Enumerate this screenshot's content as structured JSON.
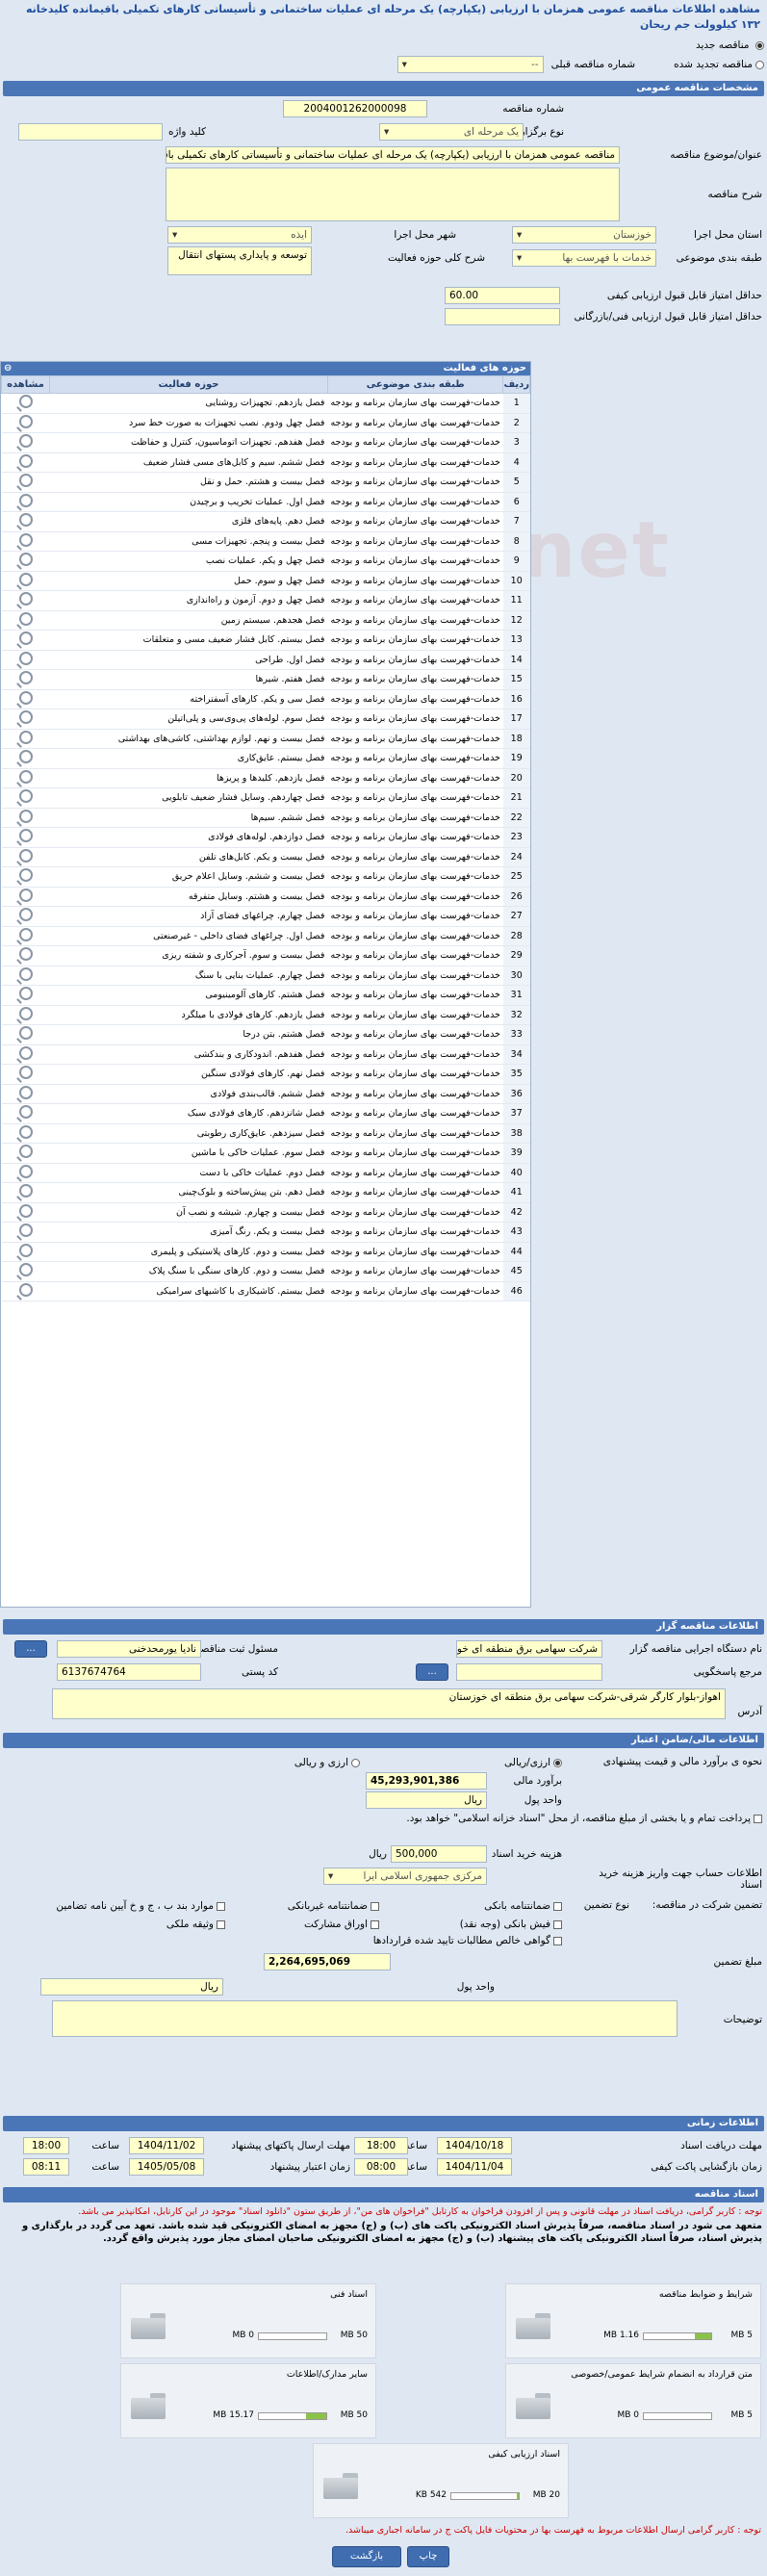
{
  "page_title": "مشاهده اطلاعات مناقصه عمومی همزمان با ارزیابی (یکپارچه) یک مرحله ای عملیات ساختمانی و تأسیساتی کارهای تکمیلی باقیمانده کلیدخانه ۱۳۲ کیلوولت جم ریحان",
  "new_tender_label": "مناقصه جدید",
  "renewed_tender_label": "مناقصه تجدید شده",
  "previous_tender_label": "شماره مناقصه قبلی",
  "previous_tender_value": "--",
  "sec_general": "مشخصات مناقصه عمومی",
  "tender_no_label": "شماره مناقصه",
  "tender_no": "2004001262000098",
  "hold_type_label": "نوع برگزاری",
  "hold_type": "یک مرحله ای",
  "keyword_label": "کلید واژه",
  "subject_label": "عنوان/موضوع مناقصه",
  "subject": "مناقصه عمومی همزمان با ارزیابی (یکپارچه) یک مرحله ای عملیات ساختمانی و تأسیساتی کارهای تکمیلی باقیمانده کلیدخانه ۱۳۲ کیلوولت جم ریحان",
  "description_label": "شرح مناقصه",
  "province_label": "استان محل اجرا",
  "province": "خوزستان",
  "city_label": "شهر محل اجرا",
  "city": "ایذه",
  "category_label": "طبقه بندی موضوعی",
  "category": "خدمات با فهرست بها",
  "scope_label": "شرح کلی حوزه فعالیت",
  "scope": "توسعه و پایداری پستهای انتقال",
  "min_quality_label": "حداقل امتیاز قابل قبول ارزیابی کیفی",
  "min_quality": "60.00",
  "min_tech_label": "حداقل امتیاز قابل قبول ارزیابی فنی/بازرگانی",
  "activity_title": "حوزه های فعالیت",
  "col_row": "ردیف",
  "col_cat": "طبقه بندی موضوعی",
  "col_act": "حوزه فعالیت",
  "col_view": "مشاهده",
  "cat_text": "خدمات-فهرست بهای سازمان برنامه و بودجه",
  "activities": [
    "فصل یازدهم. تجهیزات روشنایی",
    "فصل چهل ودوم. نصب تجهیزات به صورت خط سرد",
    "فصل هفدهم. تجهیزات اتوماسیون، کنترل و حفاظت",
    "فصل ششم. سیم و کابل‌های مسی فشار ضعیف",
    "فصل بیست و هشتم. حمل و نقل",
    "فصل اول. عملیات تخریب و برچیدن",
    "فصل دهم. پایه‌های فلزی",
    "فصل بیست و پنجم. تجهیزات مسی",
    "فصل چهل و یکم. عملیات نصب",
    "فصل چهل و سوم. حمل",
    "فصل چهل و دوم. آزمون و راه‌اندازی",
    "فصل هجدهم. سیستم زمین",
    "فصل بیستم. کابل فشار ضعیف مسی و متعلقات",
    "فصل اول. طراحی",
    "فصل هفتم. شیرها",
    "فصل سی و یکم. کارهای آسفتراخته",
    "فصل سوم. لوله‌های پی‌وی‌سی و پلی‌اتیلن",
    "فصل بیست و نهم. لوازم بهداشتی، کاشی‌های بهداشتی",
    "فصل بیستم. عایق‌کاری",
    "فصل یازدهم. کلیدها و پریزها",
    "فصل چهاردهم. وسایل فشار ضعیف تابلویی",
    "فصل ششم. سیم‌ها",
    "فصل دوازدهم. لوله‌های فولادی",
    "فصل بیست و یکم. کابل‌های تلفن",
    "فصل بیست و ششم. وسایل اعلام حریق",
    "فصل بیست و هشتم. وسایل متفرقه",
    "فصل چهارم. چراغهای فضای آزاد",
    "فصل اول. چراغهای فضای داخلی - غیرصنعتی",
    "فصل بیست و سوم. آجرکاری و شفته ریزی",
    "فصل چهارم. عملیات بنایی با سنگ",
    "فصل هشتم. کارهای آلومینیومی",
    "فصل یازدهم. کارهای فولادی با میلگرد",
    "فصل هشتم. بتن درجا",
    "فصل هفدهم. اندودکاری و بندکشی",
    "فصل نهم. کارهای فولادی سنگین",
    "فصل ششم. قالب‌بندی فولادی",
    "فصل شانزدهم. کارهای فولادی سبک",
    "فصل سیزدهم. عایق‌کاری رطوبتی",
    "فصل سوم. عملیات خاکی با ماشین",
    "فصل دوم. عملیات خاکی با دست",
    "فصل دهم. بتن پیش‌ساخته و بلوک‌چینی",
    "فصل بیست و چهارم. شیشه و نصب آن",
    "فصل بیست و یکم. رنگ آمیزی",
    "فصل بیست و دوم. کارهای پلاستیکی و پلیمری",
    "فصل بیست و دوم. کارهای سنگی با سنگ پلاک",
    "فصل بیستم. کاشیکاری با کاشیهای سرامیکی"
  ],
  "sec_organizer": "اطلاعات مناقصه گزار",
  "org_name_label": "نام دستگاه اجرایی مناقصه گزار",
  "org_name": "شرکت سهامی برق منطقه ای خوزستان",
  "contact_label": "مسئول ثبت مناقصه",
  "contact": "نادیا یورمحدخنی",
  "ref_label": "مرجع پاسخگویی",
  "postal_label": "کد پستی",
  "postal": "6137674764",
  "address_label": "آدرس",
  "address": "اهواز-بلوار کارگر شرقی-شرکت سهامی برق منطقه ای خوزستان",
  "more_btn": "...",
  "sec_finance": "اطلاعات مالی/ضامن اعتبار",
  "estimate_type_label": "نحوه ی برآورد مالی و قیمت پیشنهادی",
  "rial_label": "ارزی/ریالی",
  "fx_label": "ارزی و ریالی",
  "estimate_label": "برآورد مالی",
  "estimate": "45,293,901,386",
  "currency_label": "واحد پول",
  "currency": "ریال",
  "pay_note": "پرداخت تمام و یا بخشی از مبلغ مناقصه، از محل \"اسناد خزانه اسلامی\" خواهد بود.",
  "doc_fee_label": "هزینه خرید اسناد",
  "doc_fee": "500,000",
  "doc_fee_unit": "ریال",
  "account_label": "اطلاعات حساب جهت واریز هزینه خرید اسناد",
  "account": "مرکزی جمهوری اسلامی ایرا",
  "guarantee_label": "تضمین شرکت در مناقصه:",
  "guarantee_type_label": "نوع تضمین",
  "g_bank": "ضمانتنامه بانکی",
  "g_nonbank": "ضمانتنامه غیربانکی",
  "g_bond": "موارد بند ب ، ج و خ آیین نامه تضامین",
  "g_cash": "فیش بانکی (وجه نقد)",
  "g_securities": "اوراق مشارکت",
  "g_property": "وثیقه ملکی",
  "g_receivable": "گواهی خالص مطالبات تایید شده قراردادها",
  "guarantee_amount_label": "مبلغ تضمین",
  "guarantee_amount": "2,264,695,069",
  "guarantee_currency_label": "واحد پول",
  "guarantee_currency": "ریال",
  "notes_label": "توضیحات",
  "sec_time": "اطلاعات زمانی",
  "doc_receive_deadline_label": "مهلت دریافت اسناد",
  "doc_receive_date": "1404/10/18",
  "doc_receive_time": "18:00",
  "send_deadline_label": "مهلت ارسال پاکتهای پیشنهاد",
  "send_date": "1404/11/02",
  "send_time": "18:00",
  "open_label": "زمان بازگشایی پاکت کیفی",
  "open_date": "1404/11/04",
  "open_time": "08:00",
  "validity_label": "زمان اعتبار پیشنهاد",
  "validity_date": "1405/05/08",
  "validity_time": "08:11",
  "time_label": "ساعت",
  "sec_docs": "اسناد مناقصه",
  "docs_note1": "توجه : کاربر گرامی، دریافت اسناد در مهلت قانونی و پس از افزودن فراخوان به کارتابل \"فراخوان های من\"، از طریق ستون \"دانلود اسناد\" موجود در این کارتابل، امکانپذیر می باشد.",
  "docs_note2": "متعهد می شود در اسناد مناقصه، صرفاً پذیرش اسناد الکترونیکی پاکت های (ب) و (ج) مجهز به امضای الکترونیکی قید شده باشد. تعهد می گردد در بارگذاری و پذیرش اسناد، صرفاً اسناد الکترونیکی پاکت های پیشنهاد (ب) و (ج) مجهز به امضای الکترونیکی صاحبان امضای مجاز مورد پذیرش واقع گردد.",
  "files": [
    {
      "name": "شرایط و ضوابط مناقصه",
      "size": "1.16 MB",
      "max": "5 MB",
      "pct": 24
    },
    {
      "name": "اسناد فنی",
      "size": "0 MB",
      "max": "50 MB",
      "pct": 0
    },
    {
      "name": "متن قرارداد به انضمام شرایط عمومی/خصوصی",
      "size": "0 MB",
      "max": "5 MB",
      "pct": 0
    },
    {
      "name": "سایر مدارک/اطلاعات",
      "size": "15.17 MB",
      "max": "50 MB",
      "pct": 30
    },
    {
      "name": "اسناد ارزیابی کیفی",
      "size": "542 KB",
      "max": "20 MB",
      "pct": 3
    }
  ],
  "footer_note": "توجه : کاربر گرامی ارسال اطلاعات مربوط به فهرست بها در محتویات فایل پاکت ج در سامانه اجباری میباشد.",
  "print_btn": "چاپ",
  "back_btn": "بازگشت"
}
